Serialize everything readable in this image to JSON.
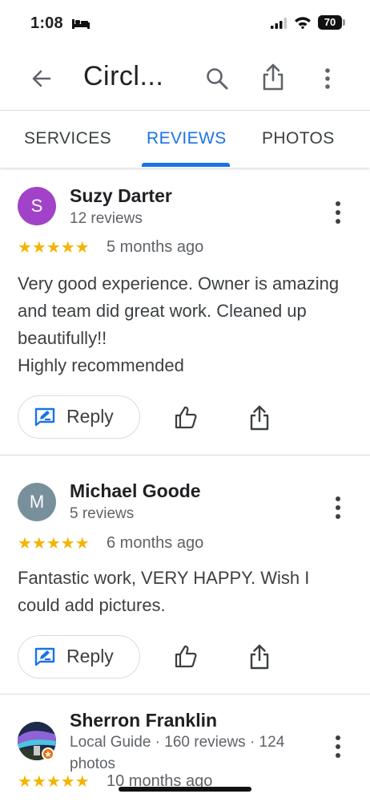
{
  "status_bar": {
    "time": "1:08",
    "battery": "70"
  },
  "app_bar": {
    "title": "Circl..."
  },
  "tabs": [
    {
      "label": "SERVICES"
    },
    {
      "label": "REVIEWS"
    },
    {
      "label": "PHOTOS"
    }
  ],
  "reviews": [
    {
      "avatar_letter": "S",
      "avatar_color": "#a142c9",
      "name": "Suzy Darter",
      "meta": "12 reviews",
      "stars": "★★★★★",
      "time": "5 months ago",
      "text": "Very good experience. Owner is amazing and team did great work. Cleaned up beautifully!!\nHighly recommended",
      "reply_label": "Reply"
    },
    {
      "avatar_letter": "M",
      "avatar_color": "#78909c",
      "name": "Michael Goode",
      "meta": "5 reviews",
      "stars": "★★★★★",
      "time": "6 months ago",
      "text": "Fantastic work, VERY HAPPY. Wish I could add pictures.",
      "reply_label": "Reply"
    },
    {
      "avatar_letter": "",
      "name": "Sherron Franklin",
      "meta": "Local Guide · 160 reviews · 124 photos",
      "stars": "★★★★★",
      "time": "10 months ago"
    }
  ],
  "colors": {
    "accent": "#1a73e8",
    "star": "#f4b400"
  }
}
